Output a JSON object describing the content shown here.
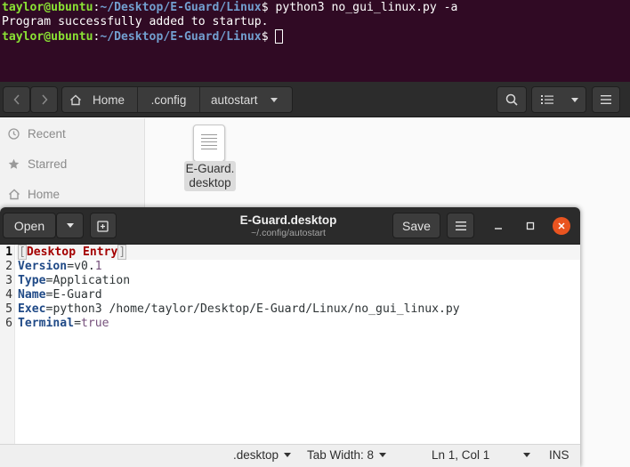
{
  "terminal": {
    "line1": {
      "user": "taylor@ubuntu",
      "sep": ":",
      "path": "~/Desktop/E-Guard/Linux",
      "prompt": "$ ",
      "command": "python3 no_gui_linux.py -a"
    },
    "line2": "Program successfully added to startup.",
    "line3": {
      "user": "taylor@ubuntu",
      "sep": ":",
      "path": "~/Desktop/E-Guard/Linux",
      "prompt": "$ "
    }
  },
  "file_manager": {
    "breadcrumbs": [
      "Home",
      ".config",
      "autostart"
    ],
    "sidebar": [
      {
        "label": "Recent",
        "icon": "clock-icon"
      },
      {
        "label": "Starred",
        "icon": "star-icon"
      },
      {
        "label": "Home",
        "icon": "home-icon"
      }
    ],
    "file": {
      "name_line1": "E-Guard.",
      "name_line2": "desktop"
    }
  },
  "gedit": {
    "open_label": "Open",
    "title": "E-Guard.desktop",
    "subtitle": "~/.config/autostart",
    "save_label": "Save",
    "lines": {
      "n1": "1",
      "n2": "2",
      "n3": "3",
      "n4": "4",
      "n5": "5",
      "n6": "6",
      "l1": "Desktop Entry",
      "l2_key": "Version",
      "l2_eq": "=",
      "l2_val_a": "v0.",
      "l2_val_b": "1",
      "l3_key": "Type",
      "l3_eq": "=",
      "l3_val": "Application",
      "l4_key": "Name",
      "l4_eq": "=",
      "l4_val": "E-Guard",
      "l5_key": "Exec",
      "l5_eq": "=",
      "l5_val": "python3 /home/taylor/Desktop/E-Guard/Linux/no_gui_linux.py",
      "l6_key": "Terminal",
      "l6_eq": "=",
      "l6_val": "true"
    },
    "status": {
      "language": ".desktop",
      "tab_width": "Tab Width: 8",
      "position": "Ln 1, Col 1",
      "mode": "INS"
    }
  },
  "colors": {
    "terminal_bg": "#300a24",
    "prompt_user": "#8ae234",
    "prompt_path": "#729fcf",
    "close_button": "#e95420",
    "section_header": "#a40000",
    "key": "#204a87"
  }
}
